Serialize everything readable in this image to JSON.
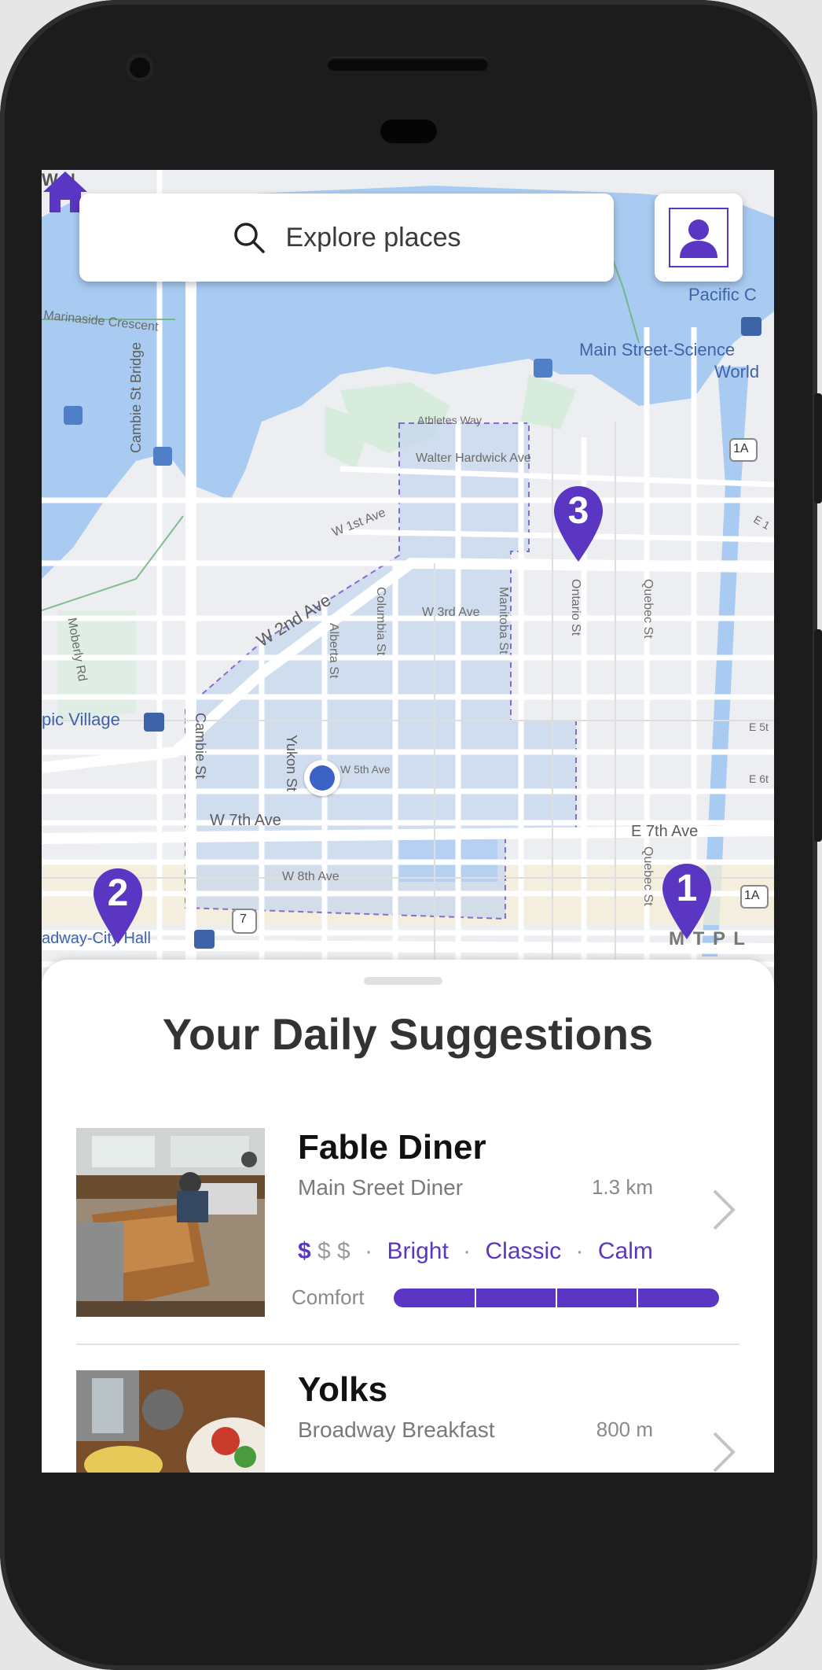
{
  "search": {
    "placeholder": "Explore places"
  },
  "map": {
    "labels": {
      "marinaside": "Marinaside Crescent",
      "cambie_bridge": "Cambie St Bridge",
      "pacific": "Pacific C",
      "main_street": "Main Street-Science",
      "world": "World",
      "athletes_way": "Athletes Way",
      "walter_hardwick": "Walter Hardwick Ave",
      "w1st": "W 1st Ave",
      "w2nd": "W 2nd Ave",
      "w3rd": "W 3rd Ave",
      "columbia": "Columbia St",
      "alberta": "Alberta St",
      "manitoba": "Manitoba St",
      "ontario": "Ontario St",
      "quebec": "Quebec St",
      "moberly": "Moberly Rd",
      "olympic_village": "pic Village",
      "cambie": "Cambie St",
      "yukon": "Yukon St",
      "w5th": "W 5th Ave",
      "w7th": "W 7th Ave",
      "w8th": "W 8th Ave",
      "e7th": "E 7th Ave",
      "e5th": "E 5t",
      "e6th": "E 6t",
      "e1st": "E 1",
      "quebec2": "Quebec St",
      "broadway": "adway-City Hall",
      "mtpl": "M T  P L",
      "hwy7": "7",
      "hwy1a_top": "1A",
      "hwy1a_bottom": "1A",
      "wn": "W N",
      "metro_m": "M"
    },
    "pins": [
      "1",
      "2",
      "3"
    ]
  },
  "sheet": {
    "title": "Your Daily Suggestions",
    "items": [
      {
        "name": "Fable Diner",
        "subtitle": "Main Sreet Diner",
        "distance": "1.3 km",
        "price_active": "$",
        "price_inactive": "$ $",
        "tags": [
          "Bright",
          "Classic",
          "Calm"
        ],
        "comfort_label": "Comfort",
        "comfort_level": 1.0
      },
      {
        "name": "Yolks",
        "subtitle": "Broadway Breakfast",
        "distance": "800 m"
      }
    ]
  },
  "colors": {
    "accent": "#5a36c2",
    "water": "#a9cbf2",
    "park": "#d7ecdc",
    "location": "#3b62c6"
  }
}
